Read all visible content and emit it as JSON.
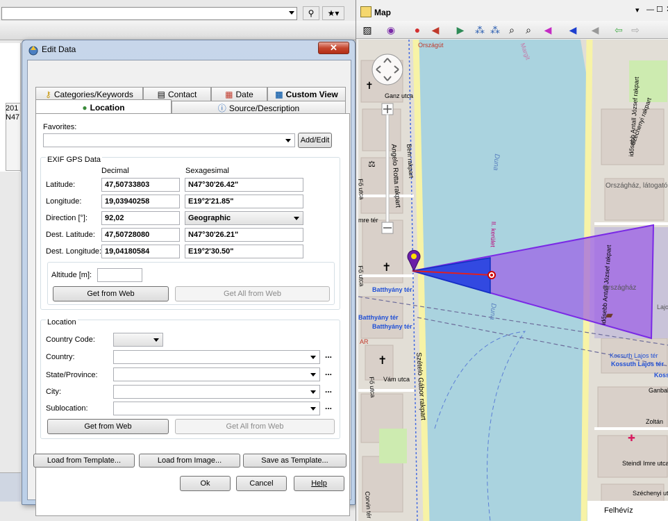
{
  "dialog": {
    "title": "Edit Data",
    "tabs_top": [
      "Categories/Keywords",
      "Contact",
      "Date",
      "Custom View"
    ],
    "tabs_bottom": [
      "Location",
      "Source/Description"
    ],
    "favorites_label": "Favorites:",
    "favorites_value": "",
    "add_edit_label": "Add/Edit",
    "exif_group_label": "EXIF GPS Data",
    "col_decimal": "Decimal",
    "col_sexagesimal": "Sexagesimal",
    "rows": [
      {
        "label": "Latitude:",
        "decimal": "47,50733803",
        "sexagesimal": "N47°30'26.42\""
      },
      {
        "label": "Longitude:",
        "decimal": "19,03940258",
        "sexagesimal": "E19°2'21.85\""
      },
      {
        "label": "Direction [°]:",
        "decimal": "92,02",
        "sexagesimal": "Geographic"
      },
      {
        "label": "Dest. Latitude:",
        "decimal": "47,50728080",
        "sexagesimal": "N47°30'26.21\""
      },
      {
        "label": "Dest. Longitude:",
        "decimal": "19,04180584",
        "sexagesimal": "E19°2'30.50\""
      }
    ],
    "altitude_label": "Altitude [m]:",
    "altitude_value": "",
    "get_from_web": "Get from Web",
    "get_all_from_web": "Get All from Web",
    "location_group_label": "Location",
    "country_code_label": "Country Code:",
    "country_label": "Country:",
    "state_label": "State/Province:",
    "city_label": "City:",
    "sublocation_label": "Sublocation:",
    "ellipsis": "...",
    "load_template": "Load from Template...",
    "load_image": "Load from Image...",
    "save_template": "Save as Template...",
    "ok": "Ok",
    "cancel": "Cancel",
    "help": "Help"
  },
  "background": {
    "cell_line1": "201",
    "cell_line2": "N47"
  },
  "map": {
    "title": "Map",
    "labels": {
      "orszagut": "Országút",
      "gyorskocsi": "Ganz utca",
      "rotta": "Angelo Rotta rakpart",
      "bem": "Bem rakpart",
      "fo_utca": "Fő utca",
      "fo_utca2": "Fő utca",
      "duna": "Duna",
      "duna2": "Duna",
      "ker": "II. kerület",
      "antall": "idősebb Antall József rakpart",
      "antall2": "idősebb Antall József rakpart",
      "szechenyi": "Széchenyi rakpart",
      "orszaghaz_lat": "Országház, látogató",
      "orszaghaz": "Országház",
      "lajos": "Lajos",
      "batthyany1": "Batthyány tér",
      "batthyany2": "Batthyány tér",
      "batthyany3": "Batthyány tér",
      "szetelo": "Szételo Gábor rakpart",
      "vam": "Vám utca",
      "kossuth": "Kossuth Lajos tér",
      "kossuth2": "Kossuth Lajos tér",
      "koss": "Koss",
      "zoltan": "Zoltán",
      "ganbal": "Ganbal",
      "steindl": "Steindl Imre utca",
      "szech_u": "Széchenyi utca",
      "felheviz": "Felhévíz",
      "corvin": "Corvin tér",
      "marg": "Margit",
      "mre_ter": "mre tér",
      "ar": "AR",
      "fo_utca3": "Fő utca"
    }
  }
}
